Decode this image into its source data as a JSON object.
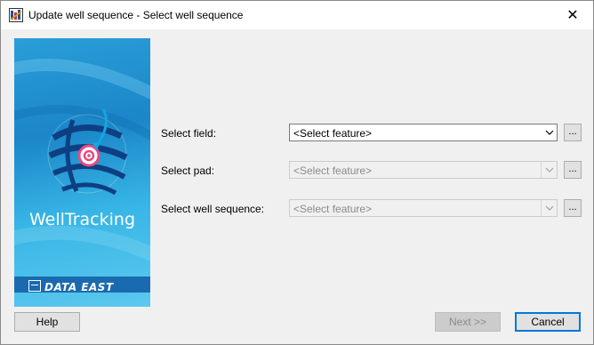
{
  "window": {
    "title": "Update well sequence - Select well sequence",
    "close_symbol": "✕",
    "icon": "app-tools-icon"
  },
  "banner": {
    "product_name": "WellTracking",
    "company_name": "DATA EAST",
    "colors": {
      "top": "#2a9ed8",
      "bottom": "#5cc8ee",
      "target": "#e84a7f"
    }
  },
  "form": {
    "field": {
      "label": "Select field:",
      "value": "<Select feature>",
      "enabled": true,
      "browse_label": "..."
    },
    "pad": {
      "label": "Select pad:",
      "value": "<Select feature>",
      "enabled": false,
      "browse_label": "..."
    },
    "well_sequence": {
      "label": "Select well sequence:",
      "value": "<Select feature>",
      "enabled": false,
      "browse_label": "..."
    }
  },
  "buttons": {
    "help": "Help",
    "next": "Next >>",
    "cancel": "Cancel"
  }
}
